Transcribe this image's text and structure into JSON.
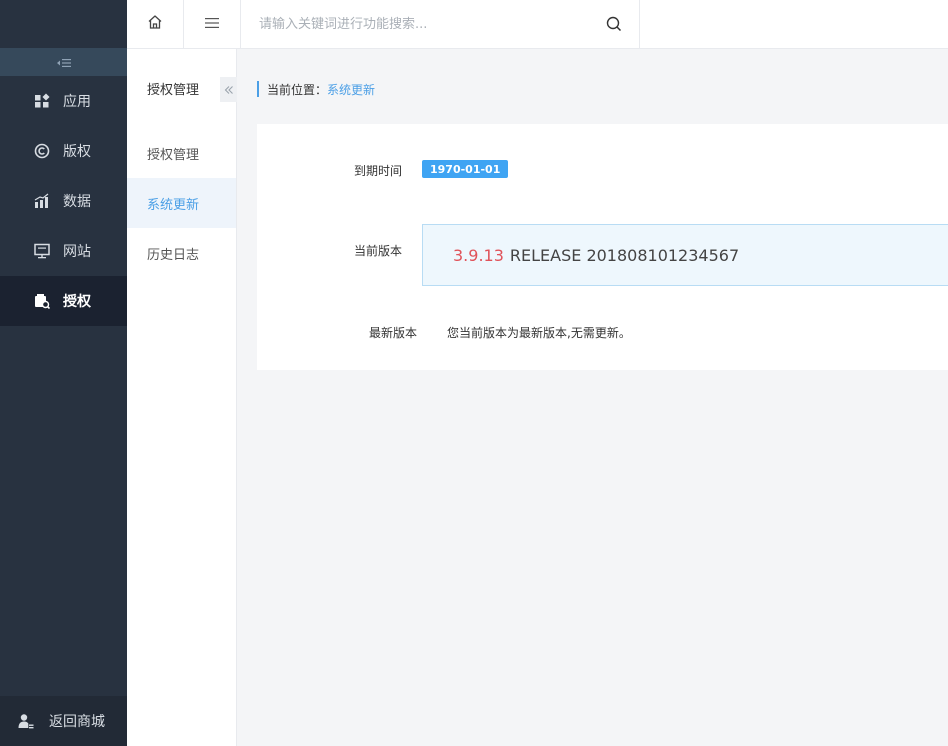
{
  "sidebar": {
    "items": [
      {
        "label": "应用",
        "icon": "apps-grid-icon"
      },
      {
        "label": "版权",
        "icon": "copyright-icon"
      },
      {
        "label": "数据",
        "icon": "bar-chart-icon"
      },
      {
        "label": "网站",
        "icon": "monitor-icon"
      },
      {
        "label": "授权",
        "icon": "license-icon",
        "active": true
      }
    ],
    "footer_label": "返回商城"
  },
  "topbar": {
    "search_placeholder": "请输入关键词进行功能搜索..."
  },
  "subnav": {
    "title": "授权管理",
    "items": [
      {
        "label": "授权管理"
      },
      {
        "label": "系统更新",
        "active": true
      },
      {
        "label": "历史日志"
      }
    ]
  },
  "breadcrumb": {
    "prefix": "当前位置：",
    "current": "系统更新"
  },
  "info": {
    "expire_label": "到期时间",
    "expire_value": "1970-01-01",
    "current_label": "当前版本",
    "version_number": "3.9.13",
    "version_rest": "RELEASE 201808101234567",
    "latest_label": "最新版本",
    "latest_text": "您当前版本为最新版本,无需更新。"
  },
  "colors": {
    "accent": "#4b9fe6",
    "badge": "#3fa4f3",
    "version_red": "#e0535a",
    "sidebar_bg": "#283240"
  }
}
